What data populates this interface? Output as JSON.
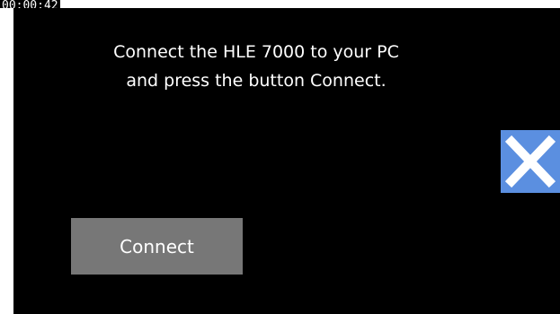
{
  "timestamp": "00:00:42",
  "dialog": {
    "message_line1": "Connect the HLE 7000 to your PC",
    "message_line2": "and press the button Connect.",
    "connect_label": "Connect",
    "close_icon": "close-icon"
  },
  "colors": {
    "screen_background": "#000000",
    "text": "#ffffff",
    "close_button": "#5b8fe0",
    "connect_button": "#777777"
  }
}
